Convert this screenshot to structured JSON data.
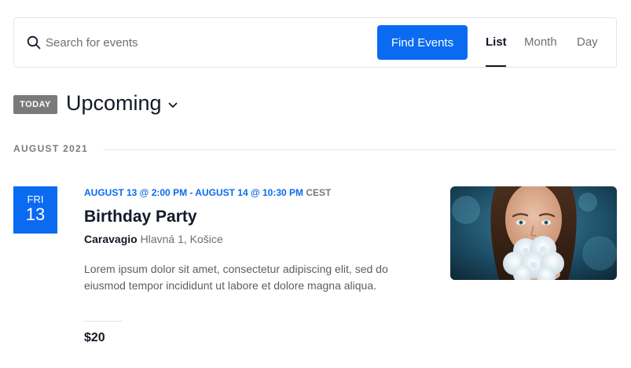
{
  "search": {
    "placeholder": "Search for events",
    "submit_label": "Find Events"
  },
  "views": [
    {
      "label": "List",
      "active": true
    },
    {
      "label": "Month",
      "active": false
    },
    {
      "label": "Day",
      "active": false
    }
  ],
  "header": {
    "today_label": "TODAY",
    "date_picker_label": "Upcoming"
  },
  "month_separator": "AUGUST 2021",
  "event": {
    "weekday": "FRI",
    "day": "13",
    "datetime": "AUGUST 13 @ 2:00 PM - AUGUST 14 @ 10:30 PM",
    "timezone": "CEST",
    "title": "Birthday Party",
    "venue_name": "Caravagio",
    "venue_address": "Hlavná 1, Košice",
    "description": "Lorem ipsum dolor sit amet, consectetur adipiscing elit, sed do eiusmod tempor incididunt ut labore et dolore magna aliqua.",
    "cost": "$20"
  },
  "colors": {
    "accent": "#0a6bf0",
    "today_badge": "#7a7a7a",
    "text_primary": "#141827",
    "text_secondary": "#6f6f6f"
  }
}
